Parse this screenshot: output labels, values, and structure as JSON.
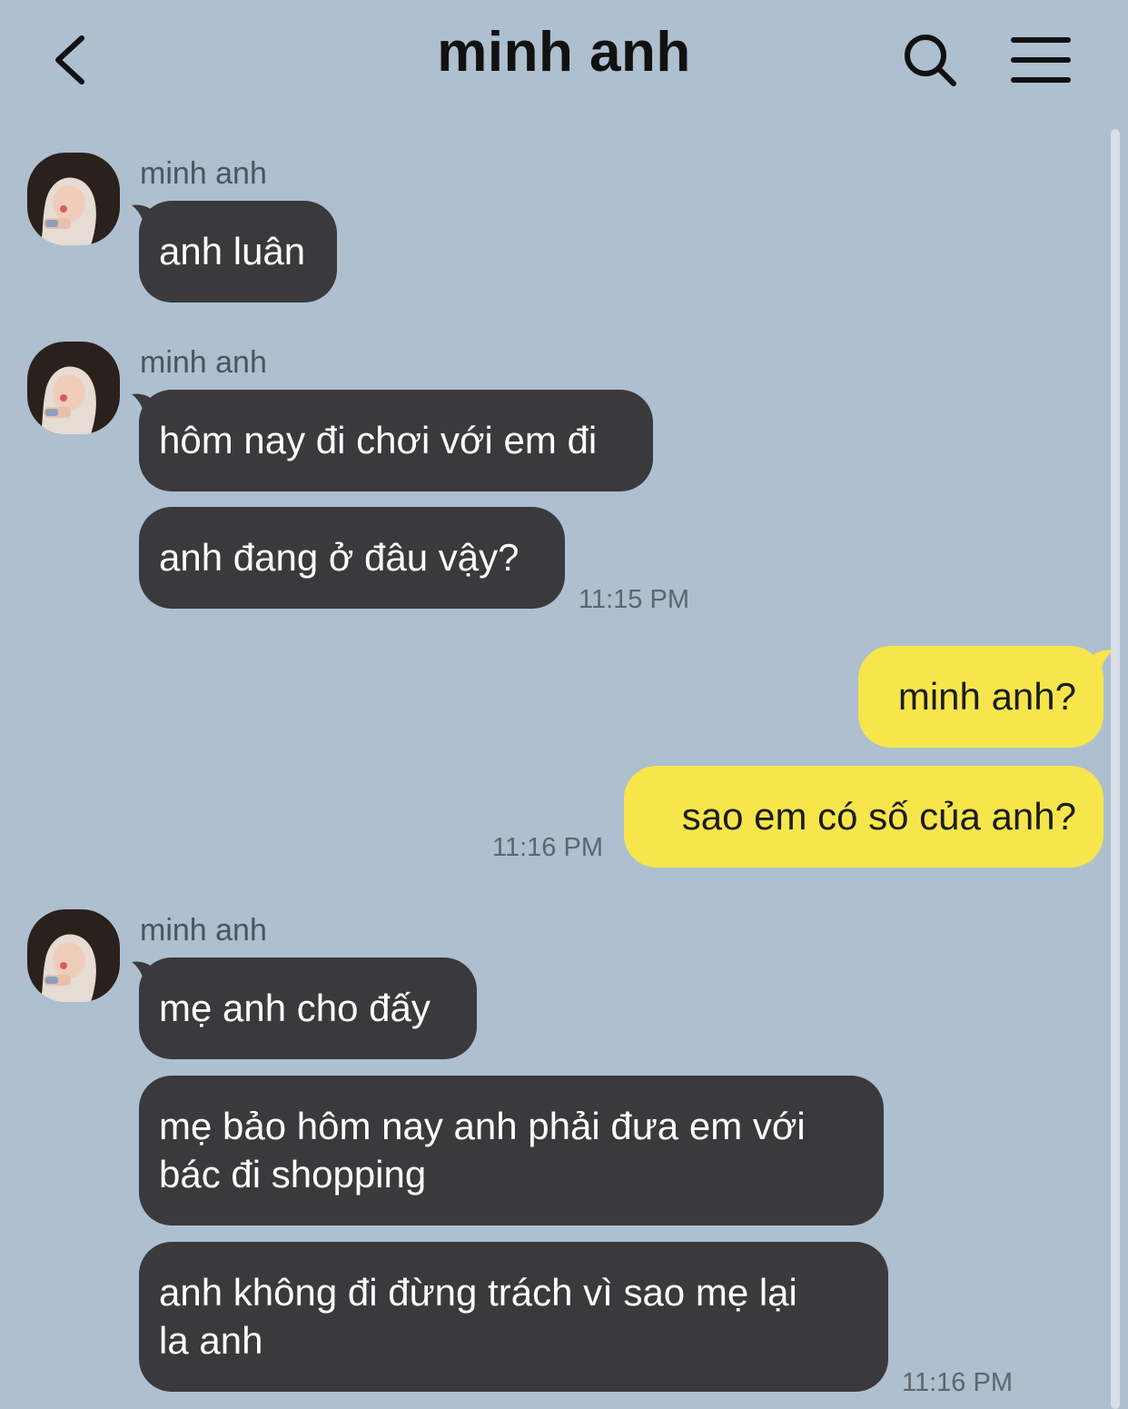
{
  "header": {
    "title": "minh anh"
  },
  "messages": {
    "sender_name": "minh anh",
    "m1": "anh luân",
    "m2": "hôm nay đi chơi với em đi",
    "m3": "anh đang ở đâu vậy?",
    "t1": "11:15 PM",
    "m4": "minh anh?",
    "m5": "sao em có số của anh?",
    "t2": "11:16 PM",
    "m6": "mẹ anh cho đấy",
    "m7_l1": "mẹ bảo hôm nay anh phải đưa em với",
    "m7_l2": "bác đi shopping",
    "m8_l1": "anh không đi đừng trách vì sao mẹ lại",
    "m8_l2": "la anh",
    "t3": "11:16 PM"
  },
  "icons": {
    "back": "chevron-left-icon",
    "search": "search-icon",
    "menu": "hamburger-menu-icon"
  },
  "colors": {
    "background": "#aebfcf",
    "incoming_bubble": "#3a3a3c",
    "outgoing_bubble": "#f6e64c"
  }
}
